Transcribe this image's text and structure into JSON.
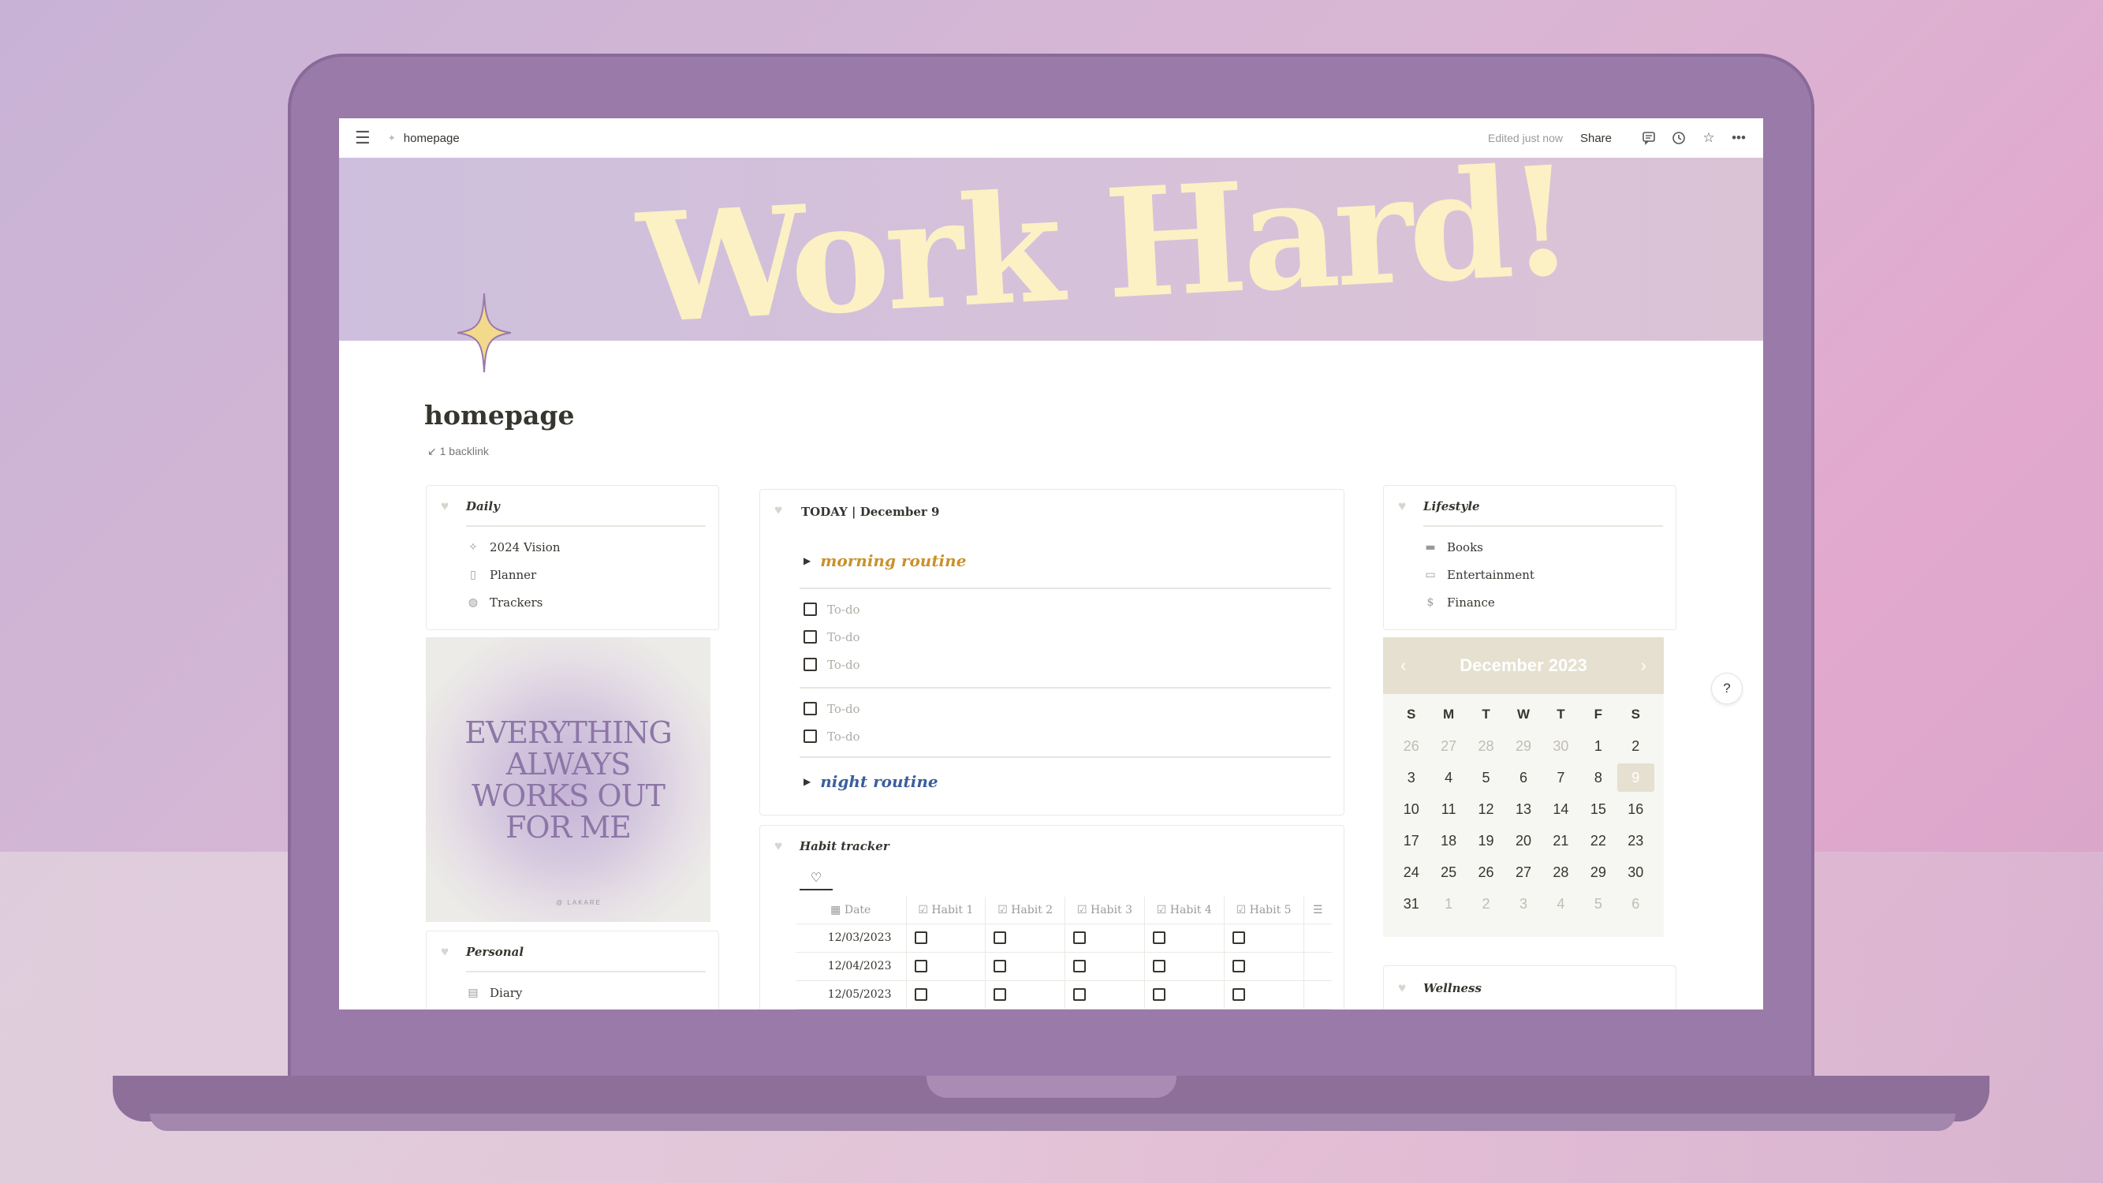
{
  "topbar": {
    "breadcrumb": "homepage",
    "edited": "Edited just now",
    "share": "Share"
  },
  "banner": {
    "text": "Work Hard!"
  },
  "page": {
    "title": "homepage",
    "backlinks": "1 backlink"
  },
  "daily": {
    "title": "Daily",
    "items": [
      {
        "label": "2024 Vision",
        "icon": "sparkle-icon"
      },
      {
        "label": "Planner",
        "icon": "page-icon"
      },
      {
        "label": "Trackers",
        "icon": "jar-icon"
      }
    ]
  },
  "affirmation": {
    "lines": [
      "EVERYTHING",
      "ALWAYS",
      "WORKS OUT",
      "FOR ME"
    ],
    "credit": "@ LAKARE"
  },
  "personal": {
    "title": "Personal",
    "items": [
      {
        "label": "Diary",
        "icon": "notebook-icon"
      }
    ]
  },
  "today": {
    "title": "TODAY | December 9",
    "morning_routine": "morning routine",
    "night_routine": "night routine",
    "todo_placeholder": "To-do",
    "group1_count": 3,
    "group2_count": 2,
    "morning_color": "#c8922a",
    "night_color": "#3b5f9c"
  },
  "habit": {
    "title": "Habit tracker",
    "view_icon": "heart-icon",
    "columns": [
      "Date",
      "Habit 1",
      "Habit 2",
      "Habit 3",
      "Habit 4",
      "Habit 5"
    ],
    "rows": [
      {
        "date": "12/03/2023"
      },
      {
        "date": "12/04/2023"
      },
      {
        "date": "12/05/2023"
      }
    ]
  },
  "lifestyle": {
    "title": "Lifestyle",
    "items": [
      {
        "label": "Books",
        "icon": "books-icon"
      },
      {
        "label": "Entertainment",
        "icon": "screen-icon"
      },
      {
        "label": "Finance",
        "icon": "money-icon"
      }
    ]
  },
  "calendar": {
    "month": "December 2023",
    "weekdays": [
      "S",
      "M",
      "T",
      "W",
      "T",
      "F",
      "S"
    ],
    "days": [
      {
        "d": "26",
        "m": true
      },
      {
        "d": "27",
        "m": true
      },
      {
        "d": "28",
        "m": true
      },
      {
        "d": "29",
        "m": true
      },
      {
        "d": "30",
        "m": true
      },
      {
        "d": "1"
      },
      {
        "d": "2"
      },
      {
        "d": "3"
      },
      {
        "d": "4"
      },
      {
        "d": "5"
      },
      {
        "d": "6"
      },
      {
        "d": "7"
      },
      {
        "d": "8"
      },
      {
        "d": "9",
        "sel": true
      },
      {
        "d": "10"
      },
      {
        "d": "11"
      },
      {
        "d": "12"
      },
      {
        "d": "13"
      },
      {
        "d": "14"
      },
      {
        "d": "15"
      },
      {
        "d": "16"
      },
      {
        "d": "17"
      },
      {
        "d": "18"
      },
      {
        "d": "19"
      },
      {
        "d": "20"
      },
      {
        "d": "21"
      },
      {
        "d": "22"
      },
      {
        "d": "23"
      },
      {
        "d": "24"
      },
      {
        "d": "25"
      },
      {
        "d": "26"
      },
      {
        "d": "27"
      },
      {
        "d": "28"
      },
      {
        "d": "29"
      },
      {
        "d": "30"
      },
      {
        "d": "31"
      },
      {
        "d": "1",
        "m": true
      },
      {
        "d": "2",
        "m": true
      },
      {
        "d": "3",
        "m": true
      },
      {
        "d": "4",
        "m": true
      },
      {
        "d": "5",
        "m": true
      },
      {
        "d": "6",
        "m": true
      }
    ]
  },
  "wellness": {
    "title": "Wellness"
  },
  "help": {
    "label": "?"
  }
}
